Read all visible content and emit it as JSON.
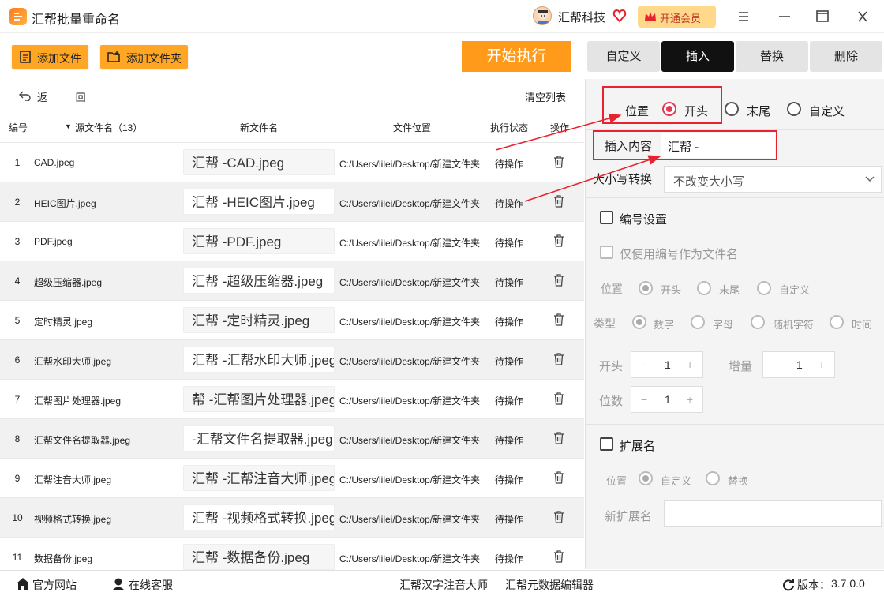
{
  "app": {
    "title": "汇帮批量重命名",
    "user": "汇帮科技",
    "vip_label": "开通会员"
  },
  "toolbar": {
    "add_file": "添加文件",
    "add_folder": "添加文件夹",
    "start": "开始执行"
  },
  "tabs": [
    "自定义",
    "插入",
    "替换",
    "删除"
  ],
  "list_nav": {
    "back": "返 回",
    "clear": "清空列表"
  },
  "columns": {
    "index": "编号",
    "source": "源文件名（13）",
    "new": "新文件名",
    "path": "文件位置",
    "status": "执行状态",
    "action": "操作"
  },
  "rows": [
    {
      "index": "1",
      "source": "CAD.jpeg",
      "new": "汇帮 -CAD.jpeg",
      "path": "C:/Users/lilei/Desktop/新建文件夹",
      "status": "待操作"
    },
    {
      "index": "2",
      "source": "HEIC图片.jpeg",
      "new": "汇帮 -HEIC图片.jpeg",
      "path": "C:/Users/lilei/Desktop/新建文件夹",
      "status": "待操作"
    },
    {
      "index": "3",
      "source": "PDF.jpeg",
      "new": "汇帮 -PDF.jpeg",
      "path": "C:/Users/lilei/Desktop/新建文件夹",
      "status": "待操作"
    },
    {
      "index": "4",
      "source": "超级压缩器.jpeg",
      "new": "汇帮 -超级压缩器.jpeg",
      "path": "C:/Users/lilei/Desktop/新建文件夹",
      "status": "待操作"
    },
    {
      "index": "5",
      "source": "定时精灵.jpeg",
      "new": "汇帮 -定时精灵.jpeg",
      "path": "C:/Users/lilei/Desktop/新建文件夹",
      "status": "待操作"
    },
    {
      "index": "6",
      "source": "汇帮水印大师.jpeg",
      "new": "汇帮 -汇帮水印大师.jpeg",
      "path": "C:/Users/lilei/Desktop/新建文件夹",
      "status": "待操作"
    },
    {
      "index": "7",
      "source": "汇帮图片处理器.jpeg",
      "new": "帮 -汇帮图片处理器.jpeg",
      "path": "C:/Users/lilei/Desktop/新建文件夹",
      "status": "待操作"
    },
    {
      "index": "8",
      "source": "汇帮文件名提取器.jpeg",
      "new": " -汇帮文件名提取器.jpeg",
      "path": "C:/Users/lilei/Desktop/新建文件夹",
      "status": "待操作"
    },
    {
      "index": "9",
      "source": "汇帮注音大师.jpeg",
      "new": "汇帮 -汇帮注音大师.jpeg",
      "path": "C:/Users/lilei/Desktop/新建文件夹",
      "status": "待操作"
    },
    {
      "index": "10",
      "source": "视频格式转换.jpeg",
      "new": "汇帮 -视频格式转换.jpeg",
      "path": "C:/Users/lilei/Desktop/新建文件夹",
      "status": "待操作"
    },
    {
      "index": "11",
      "source": "数据备份.jpeg",
      "new": "汇帮 -数据备份.jpeg",
      "path": "C:/Users/lilei/Desktop/新建文件夹",
      "status": "待操作"
    }
  ],
  "panel": {
    "position_label": "位置",
    "position_options": [
      "开头",
      "末尾",
      "自定义"
    ],
    "position_selected": "开头",
    "insert_label": "插入内容",
    "insert_value": "汇帮 -",
    "case_label": "大小写转换",
    "case_value": "不改变大小写",
    "numbering": {
      "title": "编号设置",
      "only_number": "仅使用编号作为文件名",
      "pos_label": "位置",
      "pos_options": [
        "开头",
        "末尾",
        "自定义"
      ],
      "type_label": "类型",
      "type_options": [
        "数字",
        "字母",
        "随机字符",
        "时间"
      ],
      "start_label": "开头",
      "start_value": "1",
      "step_label": "增量",
      "step_value": "1",
      "digits_label": "位数",
      "digits_value": "1"
    },
    "extension": {
      "title": "扩展名",
      "pos_label": "位置",
      "pos_options": [
        "自定义",
        "替换"
      ],
      "new_label": "新扩展名",
      "new_value": ""
    }
  },
  "statusbar": {
    "website": "官方网站",
    "service": "在线客服",
    "link1": "汇帮汉字注音大师",
    "link2": "汇帮元数据编辑器",
    "version_label": "版本：",
    "version": "3.7.0.0"
  },
  "colors": {
    "accent": "#ffa724",
    "start": "#ff9a1a",
    "active_tab": "#111111",
    "radio_on": "#e03a55",
    "highlight": "#e8232f"
  }
}
